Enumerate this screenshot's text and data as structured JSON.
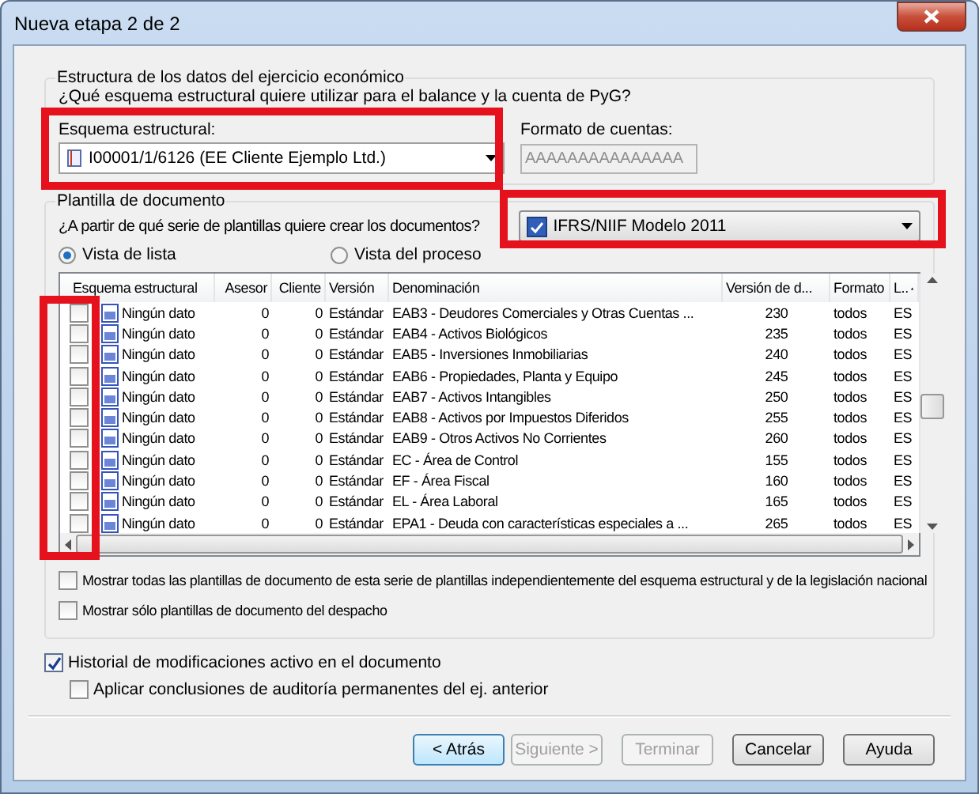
{
  "window": {
    "title": "Nueva etapa 2 de 2"
  },
  "structure_group": {
    "legend": "Estructura de los datos del ejercicio económico",
    "question": "¿Qué esquema estructural quiere utilizar para el balance y la cuenta de PyG?",
    "scheme_label": "Esquema estructural:",
    "scheme_value": "I00001/1/6126 (EE Cliente Ejemplo Ltd.)",
    "format_label": "Formato de cuentas:",
    "format_value": "AAAAAAAAAAAAAAA"
  },
  "template_group": {
    "legend": "Plantilla de documento",
    "question": "¿A partir de qué serie de plantillas quiere crear los documentos?",
    "series_value": "IFRS/NIIF Modelo 2011",
    "views": [
      {
        "label": "Vista de lista",
        "selected": true
      },
      {
        "label": "Vista del proceso",
        "selected": false
      }
    ],
    "table": {
      "columns": [
        "Esquema estructural",
        "Asesor",
        "Cliente",
        "Versión",
        "Denominación",
        "Versión de d...",
        "Formato",
        "L.."
      ],
      "rows": [
        {
          "checked": false,
          "cells": [
            "Ningún dato",
            "0",
            "0",
            "Estándar",
            "EAB3 - Deudores Comerciales y Otras Cuentas ...",
            "230",
            "todos",
            "ES"
          ]
        },
        {
          "checked": false,
          "cells": [
            "Ningún dato",
            "0",
            "0",
            "Estándar",
            "EAB4 - Activos Biológicos",
            "235",
            "todos",
            "ES"
          ]
        },
        {
          "checked": false,
          "cells": [
            "Ningún dato",
            "0",
            "0",
            "Estándar",
            "EAB5 - Inversiones Inmobiliarias",
            "240",
            "todos",
            "ES"
          ]
        },
        {
          "checked": false,
          "cells": [
            "Ningún dato",
            "0",
            "0",
            "Estándar",
            "EAB6 - Propiedades, Planta y Equipo",
            "245",
            "todos",
            "ES"
          ]
        },
        {
          "checked": false,
          "cells": [
            "Ningún dato",
            "0",
            "0",
            "Estándar",
            "EAB7 - Activos Intangibles",
            "250",
            "todos",
            "ES"
          ]
        },
        {
          "checked": false,
          "cells": [
            "Ningún dato",
            "0",
            "0",
            "Estándar",
            "EAB8 - Activos por Impuestos Diferidos",
            "255",
            "todos",
            "ES"
          ]
        },
        {
          "checked": false,
          "cells": [
            "Ningún dato",
            "0",
            "0",
            "Estándar",
            "EAB9 - Otros Activos No Corrientes",
            "260",
            "todos",
            "ES"
          ]
        },
        {
          "checked": false,
          "cells": [
            "Ningún dato",
            "0",
            "0",
            "Estándar",
            "EC - Área de Control",
            "155",
            "todos",
            "ES"
          ]
        },
        {
          "checked": false,
          "cells": [
            "Ningún dato",
            "0",
            "0",
            "Estándar",
            "EF - Área Fiscal",
            "160",
            "todos",
            "ES"
          ]
        },
        {
          "checked": false,
          "cells": [
            "Ningún dato",
            "0",
            "0",
            "Estándar",
            "EL - Área Laboral",
            "165",
            "todos",
            "ES"
          ]
        },
        {
          "checked": false,
          "cells": [
            "Ningún dato",
            "0",
            "0",
            "Estándar",
            "EPA1 - Deuda con características especiales a ...",
            "265",
            "todos",
            "ES"
          ]
        }
      ]
    },
    "options": [
      {
        "label": "Mostrar todas las plantillas de documento de esta serie de plantillas independientemente del esquema estructural y de la legislación nacional",
        "checked": false
      },
      {
        "label": "Mostrar sólo plantillas de documento del despacho",
        "checked": false
      }
    ]
  },
  "options": [
    {
      "label": "Historial de modificaciones activo en el documento",
      "checked": true,
      "indented": false
    },
    {
      "label": "Aplicar conclusiones de auditoría permanentes del ej. anterior",
      "checked": false,
      "indented": true
    }
  ],
  "buttons": [
    {
      "label": "< Atrás",
      "disabled": false,
      "default": true
    },
    {
      "label": "Siguiente >",
      "disabled": true,
      "default": false
    },
    {
      "label": "Terminar",
      "disabled": true,
      "default": false
    },
    {
      "label": "Cancelar",
      "disabled": false,
      "default": false
    },
    {
      "label": "Ayuda",
      "disabled": false,
      "default": false
    }
  ]
}
